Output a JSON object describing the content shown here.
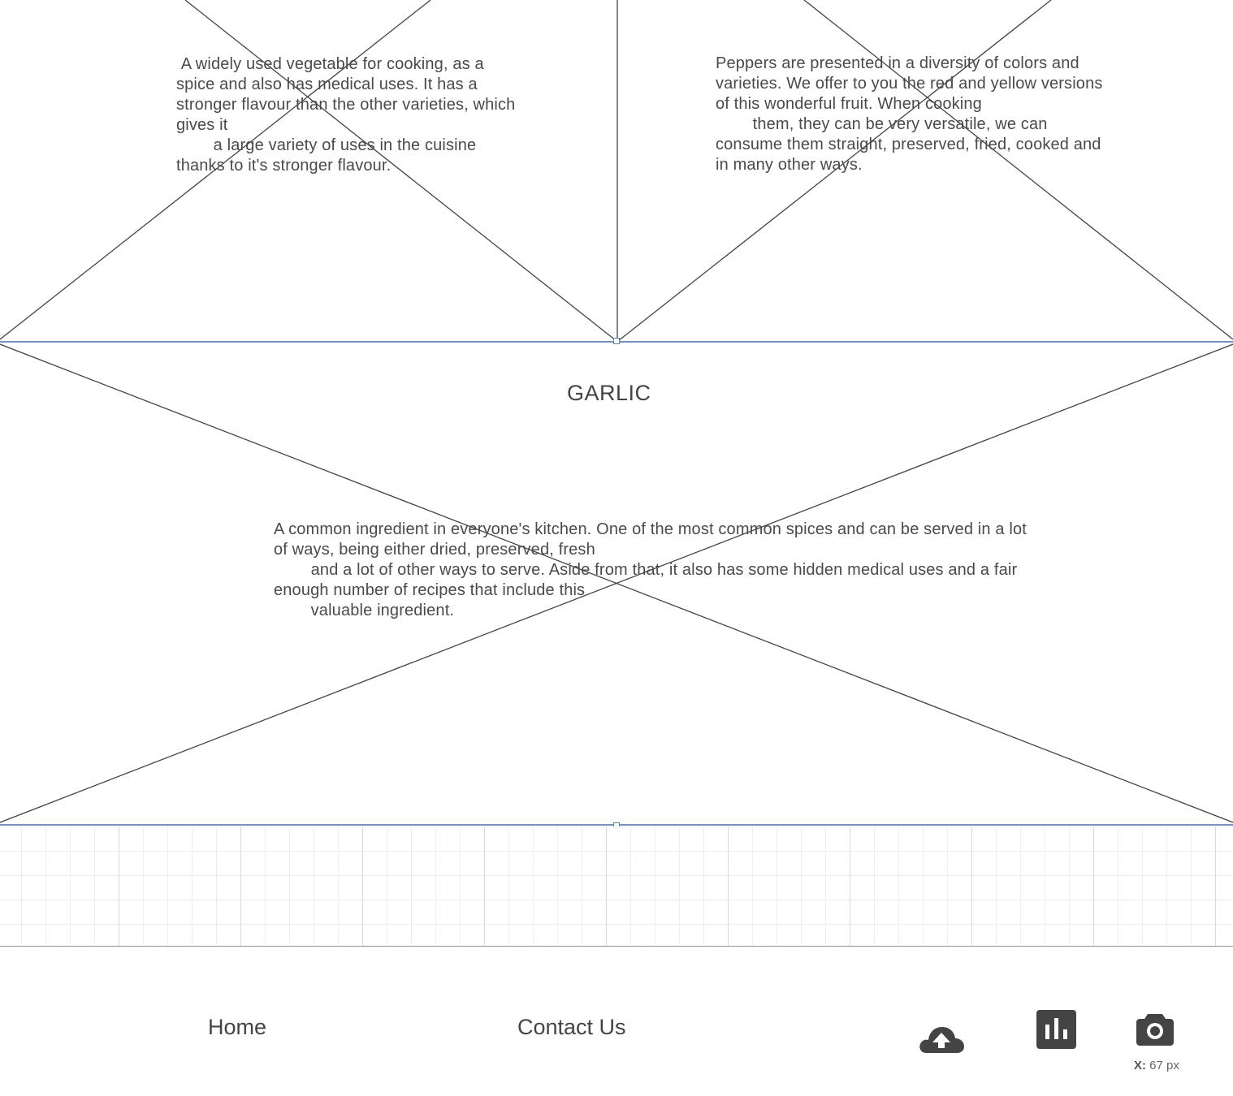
{
  "sections": {
    "onion": {
      "description": " A widely used vegetable for cooking, as a\nspice and also has medical uses. It has a\nstronger flavour than the other varieties, which\ngives it\n        a large variety of uses in the cuisine\nthanks to it's stronger flavour."
    },
    "pepper": {
      "description": "Peppers are presented in a diversity of colors and\nvarieties. We offer to you the red and yellow versions\nof this wonderful fruit. When cooking\n        them, they can be very versatile, we can\nconsume them straight, preserved, fried, cooked and\nin many other ways."
    },
    "garlic": {
      "title": "GARLIC",
      "description": "A common ingredient in everyone's kitchen. One of the most common spices and can be served in a lot\nof ways, being either dried, preserved, fresh\n        and a lot of other ways to serve. Aside from that, it also has some hidden medical uses and a fair\nenough number of recipes that include this\n        valuable ingredient."
    }
  },
  "footer": {
    "nav": {
      "home": "Home",
      "contact": "Contact Us"
    },
    "icons": [
      "cloud-upload-icon",
      "bar-chart-icon",
      "camera-icon"
    ]
  },
  "status": {
    "x_label": "X:",
    "x_value": "67 px"
  },
  "colors": {
    "text": "#4a4a4a",
    "placeholder_lines": "#444444",
    "selection": "#4a6fa5",
    "icon": "#444444"
  }
}
